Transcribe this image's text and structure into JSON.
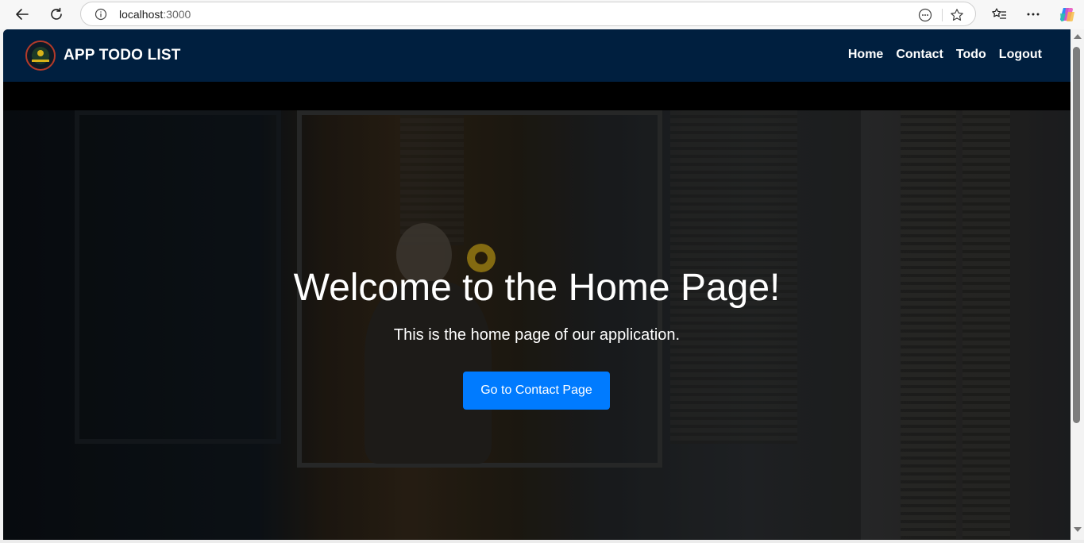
{
  "browser": {
    "url_host": "localhost",
    "url_port": ":3000"
  },
  "app": {
    "brand": "APP TODO LIST",
    "nav": [
      "Home",
      "Contact",
      "Todo",
      "Logout"
    ]
  },
  "hero": {
    "title": "Welcome to the Home Page!",
    "subtitle": "This is the home page of our application.",
    "button_label": "Go to Contact Page"
  },
  "colors": {
    "navbar": "#001f3f",
    "primary_button": "#007bff"
  },
  "icons": [
    "back-icon",
    "refresh-icon",
    "info-icon",
    "reader-mode-icon",
    "favorite-star-icon",
    "favorites-icon",
    "more-icon",
    "copilot-icon"
  ]
}
